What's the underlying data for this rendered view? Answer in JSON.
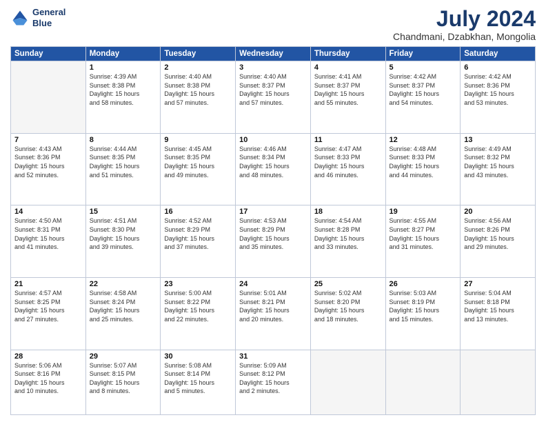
{
  "header": {
    "logo_line1": "General",
    "logo_line2": "Blue",
    "title": "July 2024",
    "subtitle": "Chandmani, Dzabkhan, Mongolia"
  },
  "days_of_week": [
    "Sunday",
    "Monday",
    "Tuesday",
    "Wednesday",
    "Thursday",
    "Friday",
    "Saturday"
  ],
  "weeks": [
    [
      {
        "day": "",
        "info": ""
      },
      {
        "day": "1",
        "info": "Sunrise: 4:39 AM\nSunset: 8:38 PM\nDaylight: 15 hours\nand 58 minutes."
      },
      {
        "day": "2",
        "info": "Sunrise: 4:40 AM\nSunset: 8:38 PM\nDaylight: 15 hours\nand 57 minutes."
      },
      {
        "day": "3",
        "info": "Sunrise: 4:40 AM\nSunset: 8:37 PM\nDaylight: 15 hours\nand 57 minutes."
      },
      {
        "day": "4",
        "info": "Sunrise: 4:41 AM\nSunset: 8:37 PM\nDaylight: 15 hours\nand 55 minutes."
      },
      {
        "day": "5",
        "info": "Sunrise: 4:42 AM\nSunset: 8:37 PM\nDaylight: 15 hours\nand 54 minutes."
      },
      {
        "day": "6",
        "info": "Sunrise: 4:42 AM\nSunset: 8:36 PM\nDaylight: 15 hours\nand 53 minutes."
      }
    ],
    [
      {
        "day": "7",
        "info": "Sunrise: 4:43 AM\nSunset: 8:36 PM\nDaylight: 15 hours\nand 52 minutes."
      },
      {
        "day": "8",
        "info": "Sunrise: 4:44 AM\nSunset: 8:35 PM\nDaylight: 15 hours\nand 51 minutes."
      },
      {
        "day": "9",
        "info": "Sunrise: 4:45 AM\nSunset: 8:35 PM\nDaylight: 15 hours\nand 49 minutes."
      },
      {
        "day": "10",
        "info": "Sunrise: 4:46 AM\nSunset: 8:34 PM\nDaylight: 15 hours\nand 48 minutes."
      },
      {
        "day": "11",
        "info": "Sunrise: 4:47 AM\nSunset: 8:33 PM\nDaylight: 15 hours\nand 46 minutes."
      },
      {
        "day": "12",
        "info": "Sunrise: 4:48 AM\nSunset: 8:33 PM\nDaylight: 15 hours\nand 44 minutes."
      },
      {
        "day": "13",
        "info": "Sunrise: 4:49 AM\nSunset: 8:32 PM\nDaylight: 15 hours\nand 43 minutes."
      }
    ],
    [
      {
        "day": "14",
        "info": "Sunrise: 4:50 AM\nSunset: 8:31 PM\nDaylight: 15 hours\nand 41 minutes."
      },
      {
        "day": "15",
        "info": "Sunrise: 4:51 AM\nSunset: 8:30 PM\nDaylight: 15 hours\nand 39 minutes."
      },
      {
        "day": "16",
        "info": "Sunrise: 4:52 AM\nSunset: 8:29 PM\nDaylight: 15 hours\nand 37 minutes."
      },
      {
        "day": "17",
        "info": "Sunrise: 4:53 AM\nSunset: 8:29 PM\nDaylight: 15 hours\nand 35 minutes."
      },
      {
        "day": "18",
        "info": "Sunrise: 4:54 AM\nSunset: 8:28 PM\nDaylight: 15 hours\nand 33 minutes."
      },
      {
        "day": "19",
        "info": "Sunrise: 4:55 AM\nSunset: 8:27 PM\nDaylight: 15 hours\nand 31 minutes."
      },
      {
        "day": "20",
        "info": "Sunrise: 4:56 AM\nSunset: 8:26 PM\nDaylight: 15 hours\nand 29 minutes."
      }
    ],
    [
      {
        "day": "21",
        "info": "Sunrise: 4:57 AM\nSunset: 8:25 PM\nDaylight: 15 hours\nand 27 minutes."
      },
      {
        "day": "22",
        "info": "Sunrise: 4:58 AM\nSunset: 8:24 PM\nDaylight: 15 hours\nand 25 minutes."
      },
      {
        "day": "23",
        "info": "Sunrise: 5:00 AM\nSunset: 8:22 PM\nDaylight: 15 hours\nand 22 minutes."
      },
      {
        "day": "24",
        "info": "Sunrise: 5:01 AM\nSunset: 8:21 PM\nDaylight: 15 hours\nand 20 minutes."
      },
      {
        "day": "25",
        "info": "Sunrise: 5:02 AM\nSunset: 8:20 PM\nDaylight: 15 hours\nand 18 minutes."
      },
      {
        "day": "26",
        "info": "Sunrise: 5:03 AM\nSunset: 8:19 PM\nDaylight: 15 hours\nand 15 minutes."
      },
      {
        "day": "27",
        "info": "Sunrise: 5:04 AM\nSunset: 8:18 PM\nDaylight: 15 hours\nand 13 minutes."
      }
    ],
    [
      {
        "day": "28",
        "info": "Sunrise: 5:06 AM\nSunset: 8:16 PM\nDaylight: 15 hours\nand 10 minutes."
      },
      {
        "day": "29",
        "info": "Sunrise: 5:07 AM\nSunset: 8:15 PM\nDaylight: 15 hours\nand 8 minutes."
      },
      {
        "day": "30",
        "info": "Sunrise: 5:08 AM\nSunset: 8:14 PM\nDaylight: 15 hours\nand 5 minutes."
      },
      {
        "day": "31",
        "info": "Sunrise: 5:09 AM\nSunset: 8:12 PM\nDaylight: 15 hours\nand 2 minutes."
      },
      {
        "day": "",
        "info": ""
      },
      {
        "day": "",
        "info": ""
      },
      {
        "day": "",
        "info": ""
      }
    ]
  ]
}
